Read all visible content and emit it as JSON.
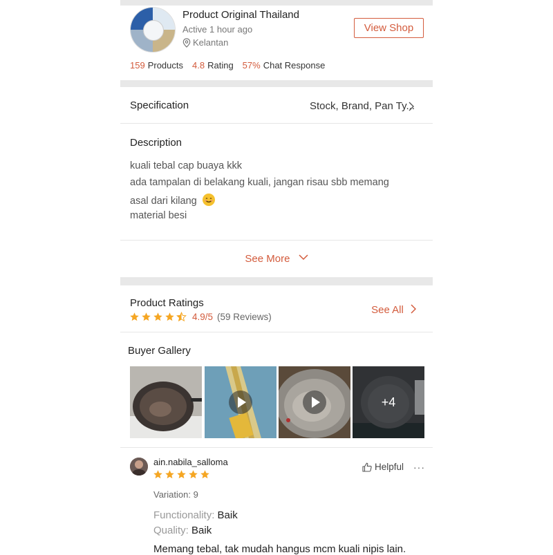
{
  "shop": {
    "name": "Product Original Thailand",
    "active": "Active 1 hour ago",
    "location": "Kelantan",
    "view_shop_label": "View Shop",
    "stats": [
      {
        "value": "159",
        "label": "Products"
      },
      {
        "value": "4.8",
        "label": "Rating"
      },
      {
        "value": "57%",
        "label": "Chat Response"
      }
    ]
  },
  "specification": {
    "label": "Specification",
    "value": "Stock, Brand, Pan Ty..."
  },
  "description": {
    "title": "Description",
    "lines": [
      "kuali tebal cap buaya kkk",
      "ada tampalan di belakang kuali, jangan risau sbb memang",
      "asal dari kilang",
      "material besi"
    ],
    "see_more_label": "See More"
  },
  "ratings": {
    "title": "Product Ratings",
    "score": "4.9/5",
    "count": "(59 Reviews)",
    "stars": 4.5,
    "see_all_label": "See All"
  },
  "gallery": {
    "title": "Buyer Gallery",
    "more_count": "+4"
  },
  "review": {
    "user": "ain.nabila_salloma",
    "stars": 5,
    "helpful_label": "Helpful",
    "more_label": "···",
    "variation": "Variation: 9",
    "functionality_label": "Functionality:",
    "functionality_value": "Baik",
    "quality_label": "Quality:",
    "quality_value": "Baik",
    "text": "Memang tebal, tak mudah hangus mcm kuali nipis lain."
  },
  "colors": {
    "accent": "#d35b3c",
    "star": "#f5a623",
    "separator": "#e8e8e8"
  }
}
